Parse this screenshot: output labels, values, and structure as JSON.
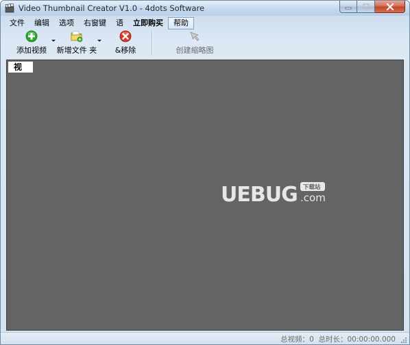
{
  "window": {
    "title": "Video Thumbnail Creator V1.0 - 4dots Software"
  },
  "menu": {
    "items": [
      {
        "label": "文件"
      },
      {
        "label": "编辑"
      },
      {
        "label": "选项"
      },
      {
        "label": "右窗键"
      },
      {
        "label": "语"
      },
      {
        "label": "立即购买"
      },
      {
        "label": "帮助"
      }
    ]
  },
  "toolbar": {
    "add_video_label": "添加视频",
    "add_folder_label": "新增文件 夹",
    "remove_label": "&移除",
    "create_thumbnails_label": "创建缩略图"
  },
  "list": {
    "column_header": "视"
  },
  "watermark": {
    "brand": "UEBUG",
    "badge": "下载站",
    "suffix": ".com"
  },
  "status": {
    "total_videos_label": "总视频：",
    "total_videos_value": "0",
    "total_duration_label": "总时长：",
    "total_duration_value": "00:00:00.000"
  },
  "colors": {
    "content_bg": "#646464",
    "add_icon": "#2ea62e",
    "remove_icon": "#d83a2a"
  }
}
